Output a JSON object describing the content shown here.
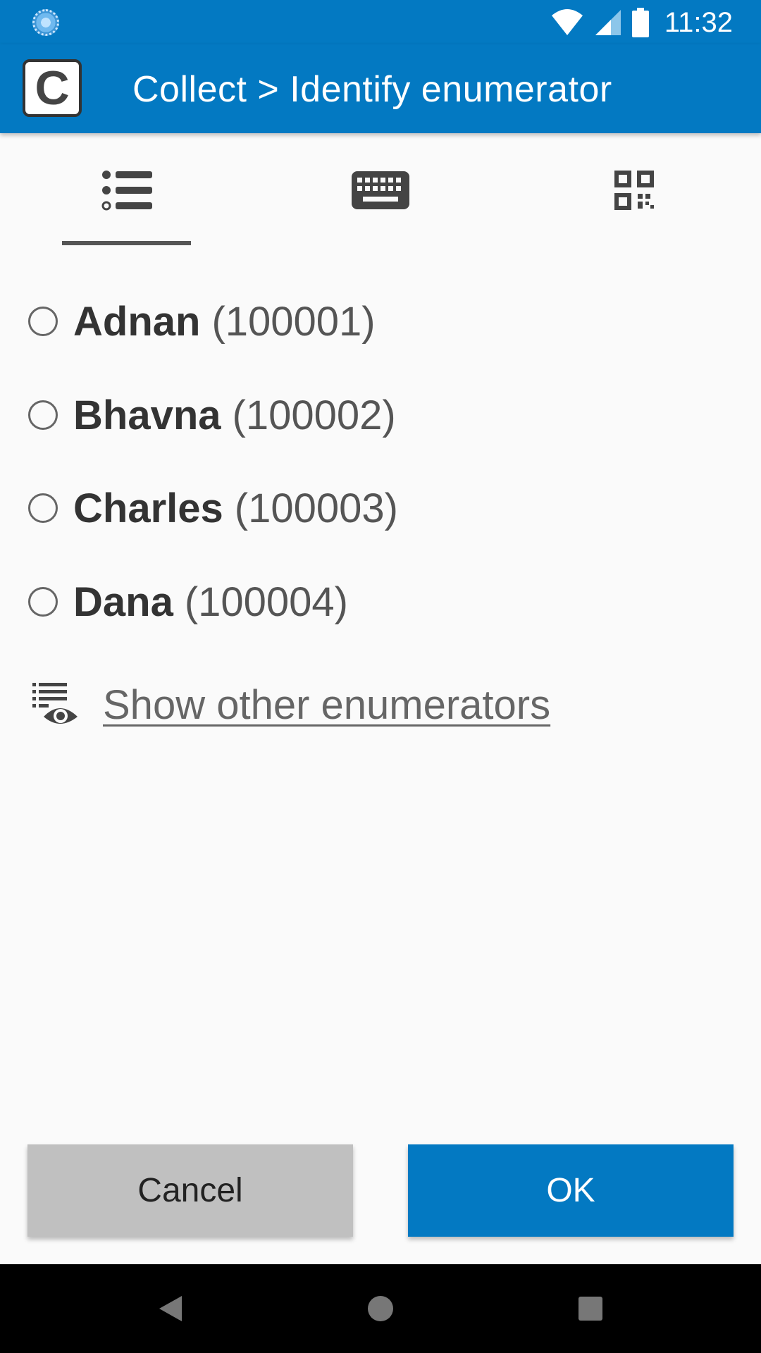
{
  "status_bar": {
    "time": "11:32",
    "icons": [
      "sync-icon",
      "wifi-icon",
      "cellular-signal-icon",
      "battery-icon"
    ]
  },
  "app_bar": {
    "logo_letter": "C",
    "title": "Collect > Identify enumerator"
  },
  "tabs": [
    {
      "icon": "list-icon",
      "selected": true
    },
    {
      "icon": "keyboard-icon",
      "selected": false
    },
    {
      "icon": "qr-code-icon",
      "selected": false
    }
  ],
  "enumerators": [
    {
      "name": "Adnan",
      "code": "(100001)",
      "selected": false
    },
    {
      "name": "Bhavna",
      "code": "(100002)",
      "selected": false
    },
    {
      "name": "Charles",
      "code": "(100003)",
      "selected": false
    },
    {
      "name": "Dana",
      "code": "(100004)",
      "selected": false
    }
  ],
  "show_other": {
    "icon": "list-view-eye-icon",
    "label": "Show other enumerators"
  },
  "buttons": {
    "cancel": "Cancel",
    "ok": "OK"
  },
  "nav_bar": {
    "icons": [
      "back-icon",
      "home-icon",
      "recents-icon"
    ]
  },
  "colors": {
    "primary": "#0379c2",
    "cancel_bg": "#c0c0c0",
    "background": "#fafafa"
  }
}
